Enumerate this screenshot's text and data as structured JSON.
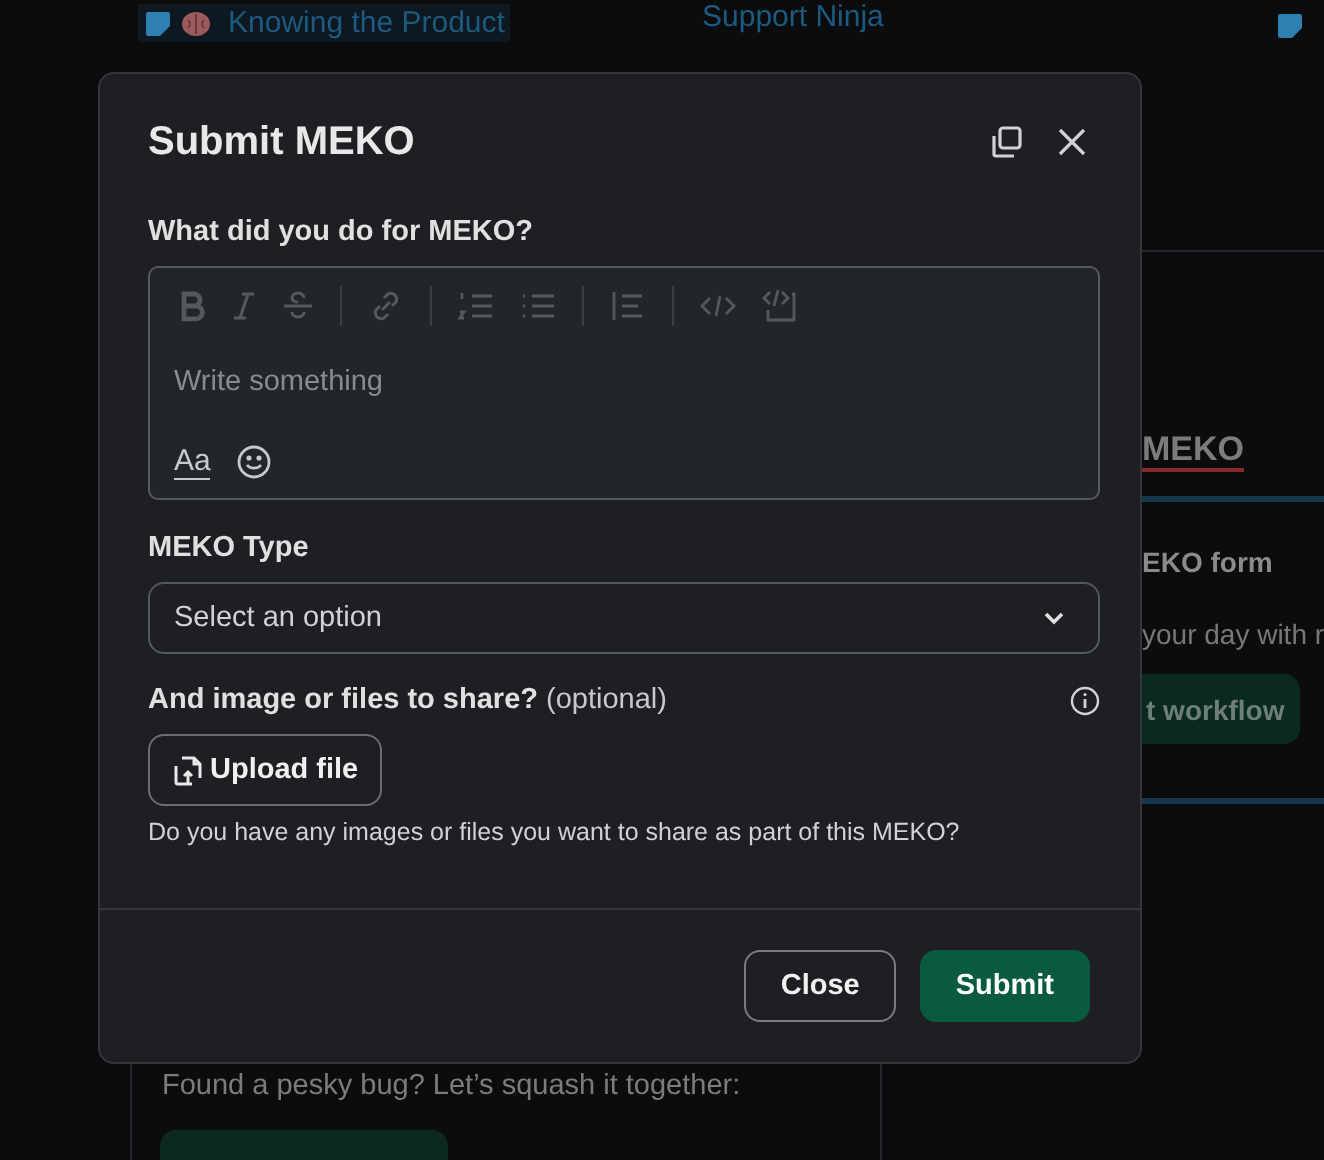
{
  "background": {
    "header_links": [
      {
        "label": "Knowing the Product"
      },
      {
        "label": "Support Ninja"
      }
    ],
    "side_card": {
      "heading": "MEKO",
      "subheading": "EKO form",
      "text": "your day with r",
      "button": "t workflow"
    },
    "bottom_card": {
      "text": "Found a pesky bug? Let’s squash it together:"
    }
  },
  "dialog": {
    "title": "Submit MEKO",
    "fields": [
      {
        "kind": "richtext",
        "label": "What did you do for MEKO?",
        "placeholder": "Write something",
        "format_label": "Aa"
      },
      {
        "kind": "select",
        "label": "MEKO Type",
        "placeholder": "Select an option"
      },
      {
        "kind": "file",
        "label": "And image or files to share?",
        "note": "(optional)",
        "button": "Upload file",
        "hint": "Do you have any images or files you want to share as part of this MEKO?"
      }
    ],
    "buttons": [
      {
        "label": "Close",
        "kind": "secondary"
      },
      {
        "label": "Submit",
        "kind": "primary"
      }
    ]
  }
}
